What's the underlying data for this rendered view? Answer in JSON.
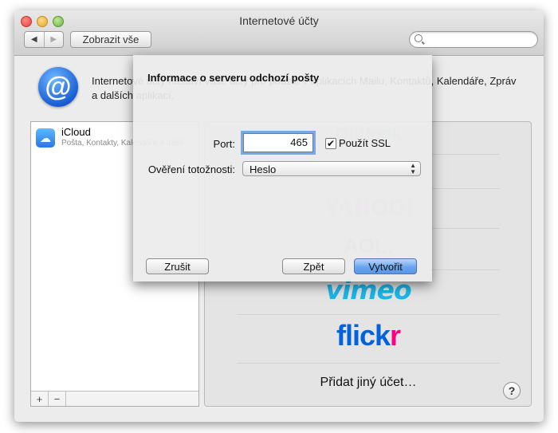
{
  "window": {
    "title": "Internetové účty"
  },
  "toolbar": {
    "back_glyph": "◀",
    "forward_glyph": "▶",
    "show_all_label": "Zobrazit vše",
    "search_placeholder": ""
  },
  "header": {
    "description": "Internetové účty nastaví vaše účty pro použití v aplikacích Mailu, Kontaktů, Kalendáře, Zpráv a dalších aplikací."
  },
  "sidebar": {
    "accounts": [
      {
        "name": "iCloud",
        "subtitle": "Pošta, Kontakty, Kalendáře a další"
      }
    ],
    "add_label": "+",
    "remove_label": "−"
  },
  "providers": {
    "faded": [
      "Outlook",
      "LinkedIn",
      "YAHOO!",
      "AOL."
    ],
    "vimeo": "vimeo",
    "flickr_main": "flick",
    "flickr_r": "r",
    "add_other": "Přidat jiný účet…",
    "help_label": "?"
  },
  "sheet": {
    "title": "Informace o serveru odchozí pošty",
    "port_label": "Port:",
    "port_value": "465",
    "ssl_label": "Použít SSL",
    "ssl_checked": true,
    "ssl_check_glyph": "✔",
    "auth_label": "Ověření totožnosti:",
    "auth_value": "Heslo",
    "auth_arrows_up": "▲",
    "auth_arrows_down": "▼",
    "cancel_label": "Zrušit",
    "back_label": "Zpět",
    "create_label": "Vytvořit"
  },
  "colors": {
    "accent": "#5a97e6",
    "vimeo": "#1ab7ea",
    "flickr_blue": "#0063dc",
    "flickr_pink": "#ff0084"
  }
}
